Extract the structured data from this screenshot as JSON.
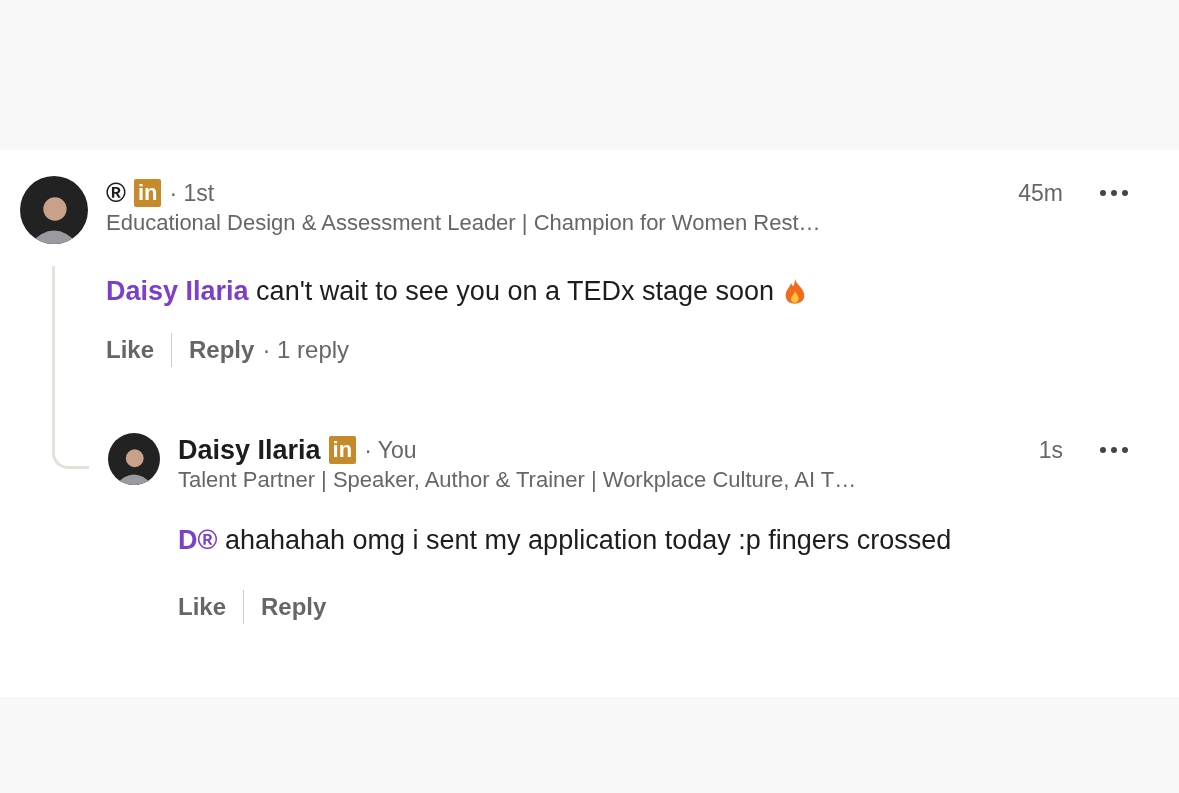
{
  "comments": [
    {
      "author": "®",
      "badge": "in",
      "connection": "· 1st",
      "time": "45m",
      "headline": "Educational Design & Assessment Leader | Champion for Women Rest…",
      "mention": "Daisy Ilaria",
      "text": "can't wait to see you on a TEDx stage soon",
      "actions": [
        "Like",
        "Reply"
      ],
      "reply_count": "· 1 reply",
      "replies": [
        {
          "author": "Daisy Ilaria",
          "badge": "in",
          "connection": "· You",
          "time": "1s",
          "headline": "Talent Partner | Speaker, Author & Trainer | Workplace Culture, AI T…",
          "mention": "D®",
          "text": "ahahahah omg i sent my application today :p fingers crossed",
          "actions": [
            "Like",
            "Reply"
          ]
        }
      ]
    }
  ]
}
